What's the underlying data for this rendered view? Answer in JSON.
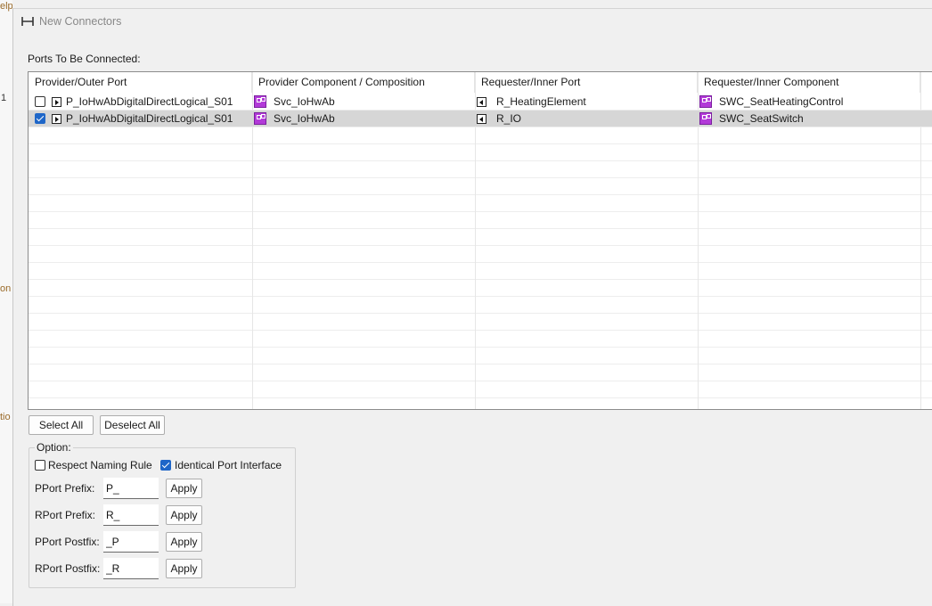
{
  "background_fragments": [
    "elp",
    "on",
    "tio",
    "1"
  ],
  "window": {
    "title": "New Connectors",
    "icon": "connector-icon"
  },
  "section_label": "Ports To Be Connected:",
  "table": {
    "columns": [
      "Provider/Outer Port",
      "Provider Component / Composition",
      "Requester/Inner Port",
      "Requester/Inner Component"
    ],
    "rows": [
      {
        "checked": false,
        "provider_port": "P_IoHwAbDigitalDirectLogical_S01",
        "provider_component": "Svc_IoHwAb",
        "requester_port": "R_HeatingElement",
        "requester_component": "SWC_SeatHeatingControl"
      },
      {
        "checked": true,
        "provider_port": "P_IoHwAbDigitalDirectLogical_S01",
        "provider_component": "Svc_IoHwAb",
        "requester_port": "R_IO",
        "requester_component": "SWC_SeatSwitch"
      }
    ]
  },
  "buttons": {
    "select_all": "Select All",
    "deselect_all": "Deselect All"
  },
  "options": {
    "group_label": "Option:",
    "respect_naming_rule": {
      "label": "Respect Naming Rule",
      "checked": false
    },
    "identical_port_interface": {
      "label": "Identical Port Interface",
      "checked": true
    },
    "fields": [
      {
        "label": "PPort Prefix:",
        "value": "P_",
        "apply": "Apply"
      },
      {
        "label": "RPort Prefix:",
        "value": "R_",
        "apply": "Apply"
      },
      {
        "label": "PPort Postfix:",
        "value": "_P",
        "apply": "Apply"
      },
      {
        "label": "RPort Postfix:",
        "value": "_R",
        "apply": "Apply"
      }
    ]
  },
  "colors": {
    "accent": "#1e66c8",
    "component_icon": "#b23ad8",
    "selected_row": "#d6d6d6"
  }
}
